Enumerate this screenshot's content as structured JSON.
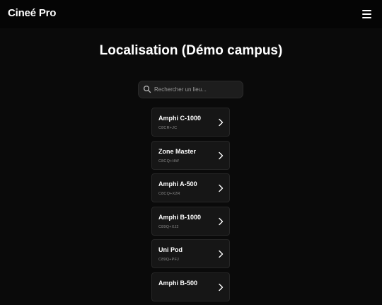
{
  "header": {
    "app_title": "Cineé Pro",
    "menu_icon": "hamburger-menu-icon"
  },
  "main": {
    "title": "Localisation (Démo campus)",
    "search": {
      "placeholder": "Rechercher un lieu...",
      "value": "",
      "icon": "search-icon"
    },
    "locations": [
      {
        "name": "Amphi C-1000",
        "code": "C8CR+JC"
      },
      {
        "name": "Zone Master",
        "code": "C8CQ+HW"
      },
      {
        "name": "Amphi A-500",
        "code": "C8CQ+X2R"
      },
      {
        "name": "Amphi B-1000",
        "code": "C89Q+XJ2"
      },
      {
        "name": "Uni Pod",
        "code": "C89Q+PFJ"
      },
      {
        "name": "Amphi B-500",
        "code": ""
      }
    ]
  },
  "colors": {
    "background": "#0a0a0a",
    "card": "#161616",
    "card_border": "#262626",
    "text": "#ffffff",
    "muted": "#8a8a8a"
  }
}
